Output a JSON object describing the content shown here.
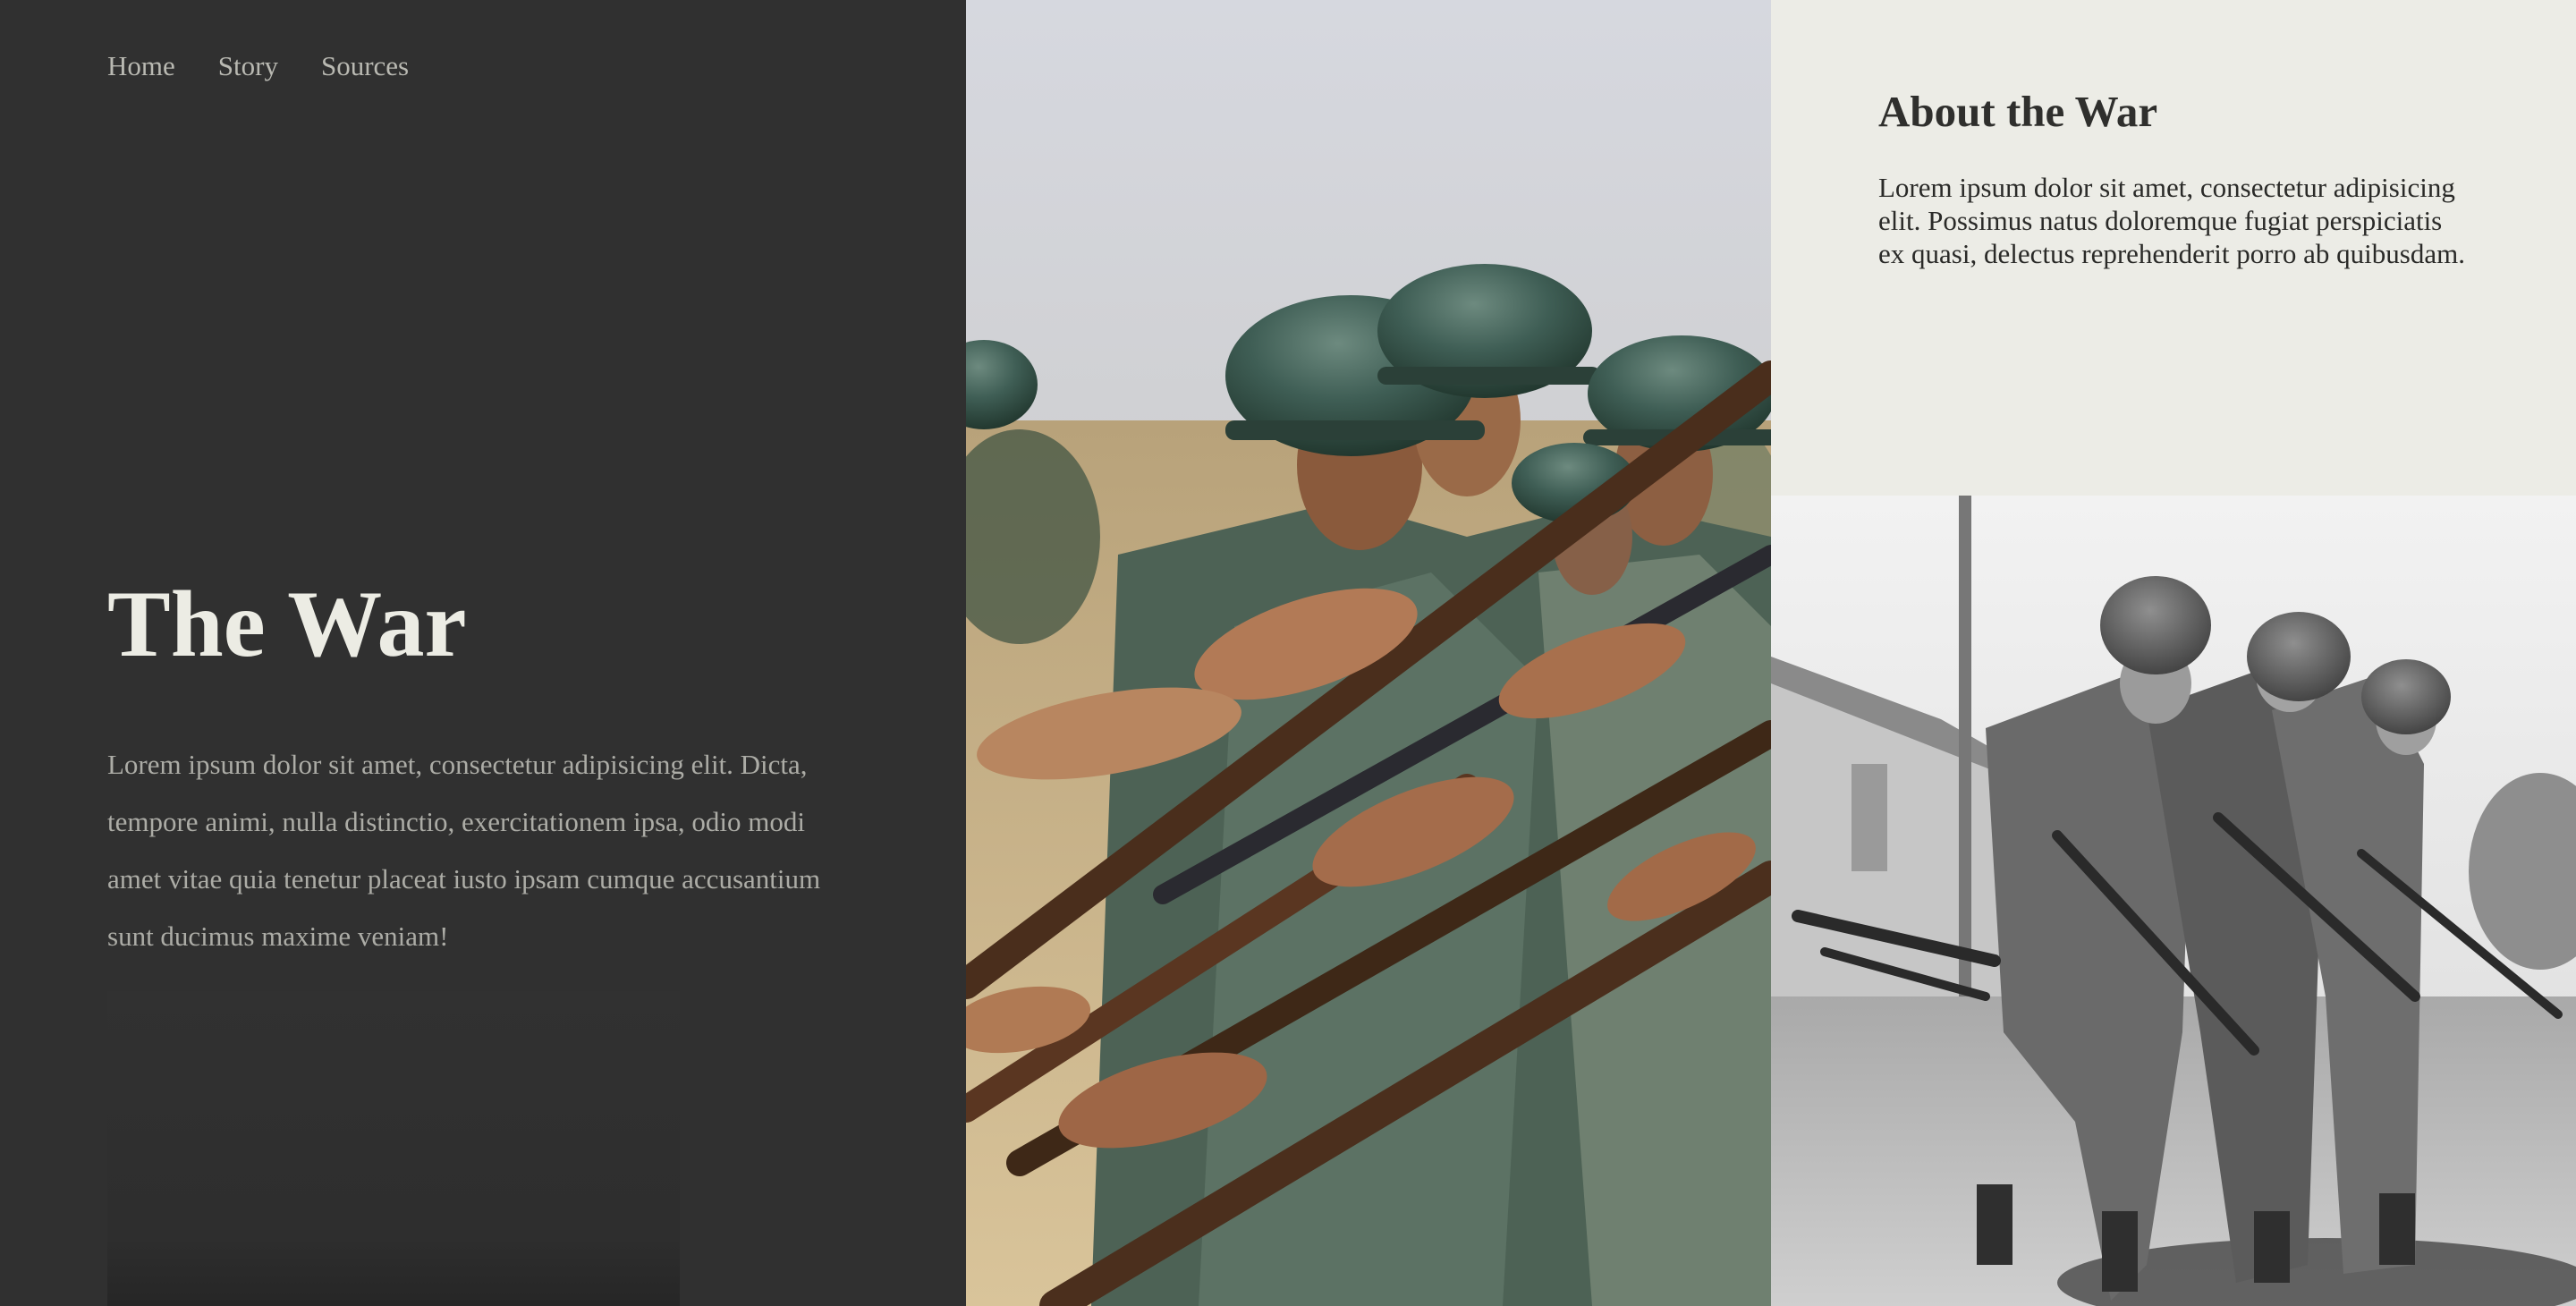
{
  "nav": {
    "items": [
      {
        "label": "Home"
      },
      {
        "label": "Story"
      },
      {
        "label": "Sources"
      }
    ]
  },
  "hero": {
    "title": "The War",
    "text": "Lorem ipsum dolor sit amet, consectetur adipisicing elit. Dicta, tempore animi, nulla distinctio, exercitationem ipsa, odio modi amet vitae quia tenetur placeat iusto ipsam cumque accusantium sunt ducimus maxime veniam!"
  },
  "about": {
    "title": "About the War",
    "text": "Lorem ipsum dolor sit amet, consectetur adipisicing elit. Possimus natus doloremque fugiat perspiciatis ex quasi, delectus reprehenderit porro ab quibusdam."
  },
  "images": {
    "middle": "soldiers-with-rifles-color-photo",
    "right": "soldiers-black-and-white-photo"
  },
  "colors": {
    "dark_panel": "#303030",
    "light_panel": "#ecece6",
    "hero_title": "#ecece4",
    "nav_text": "#b9b9b2"
  }
}
